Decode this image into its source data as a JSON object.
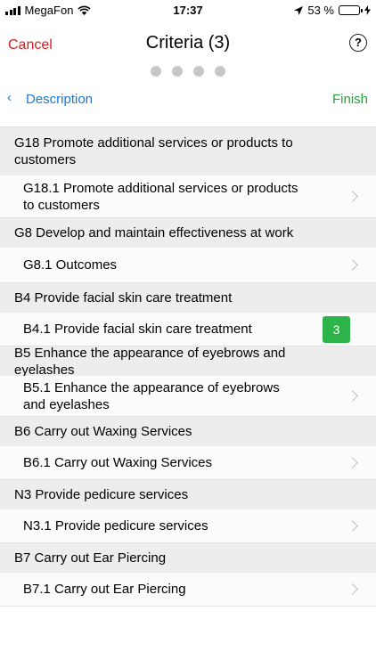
{
  "status_bar": {
    "carrier": "MegaFon",
    "time": "17:37",
    "battery": "53 %",
    "battery_level": 0.53
  },
  "nav": {
    "cancel": "Cancel",
    "title": "Criteria (3)",
    "help": "?"
  },
  "steps": {
    "count": 4,
    "back": "Description",
    "finish": "Finish"
  },
  "sections": [
    {
      "header": "G18 Promote additional services or products to customers",
      "items": [
        {
          "label": "G18.1 Promote additional services or products to customers",
          "badge": null
        }
      ]
    },
    {
      "header": "G8 Develop and maintain effectiveness at work",
      "items": [
        {
          "label": "G8.1 Outcomes",
          "badge": null
        }
      ]
    },
    {
      "header": "B4 Provide facial skin care treatment",
      "items": [
        {
          "label": "B4.1 Provide facial skin care treatment",
          "badge": "3"
        }
      ]
    },
    {
      "header": "B5 Enhance the appearance of eyebrows and eyelashes",
      "items": [
        {
          "label": "B5.1 Enhance the appearance of eyebrows and eyelashes",
          "badge": null
        }
      ]
    },
    {
      "header": "B6 Carry out Waxing Services",
      "items": [
        {
          "label": "B6.1 Carry out Waxing Services",
          "badge": null
        }
      ]
    },
    {
      "header": "N3 Provide pedicure services",
      "items": [
        {
          "label": "N3.1 Provide pedicure services",
          "badge": null
        }
      ]
    },
    {
      "header": "B7 Carry out Ear Piercing",
      "items": [
        {
          "label": "B7.1 Carry out Ear Piercing",
          "badge": null
        }
      ]
    }
  ],
  "colors": {
    "cancel": "#d0231f",
    "link": "#1a7ad6",
    "finish": "#25a33a",
    "badge": "#2cb34a"
  }
}
